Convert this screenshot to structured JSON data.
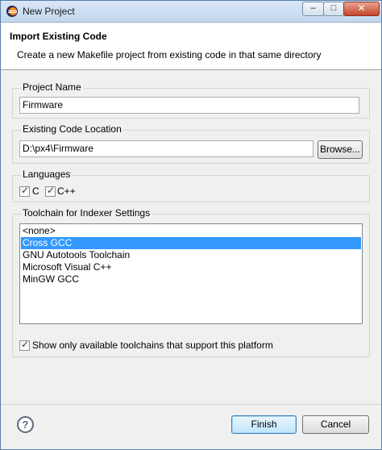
{
  "window": {
    "title": "New Project",
    "controls": {
      "minimize": "–",
      "maximize": "□",
      "close": "✕"
    }
  },
  "header": {
    "title": "Import Existing Code",
    "description": "Create a new Makefile project from existing code in that same directory"
  },
  "project_name": {
    "label": "Project Name",
    "value": "Firmware"
  },
  "code_location": {
    "label": "Existing Code Location",
    "value": "D:\\px4\\Firmware",
    "browse_label": "Browse..."
  },
  "languages": {
    "label": "Languages",
    "c": {
      "label": "C",
      "checked": true
    },
    "cpp": {
      "label": "C++",
      "checked": true
    }
  },
  "toolchain": {
    "label": "Toolchain for Indexer Settings",
    "items": [
      "<none>",
      "Cross GCC",
      "GNU Autotools Toolchain",
      "Microsoft Visual C++",
      "MinGW GCC"
    ],
    "selected_index": 1,
    "filter": {
      "label": "Show only available toolchains that support this platform",
      "checked": true
    }
  },
  "footer": {
    "help_glyph": "?",
    "finish_label": "Finish",
    "cancel_label": "Cancel"
  }
}
